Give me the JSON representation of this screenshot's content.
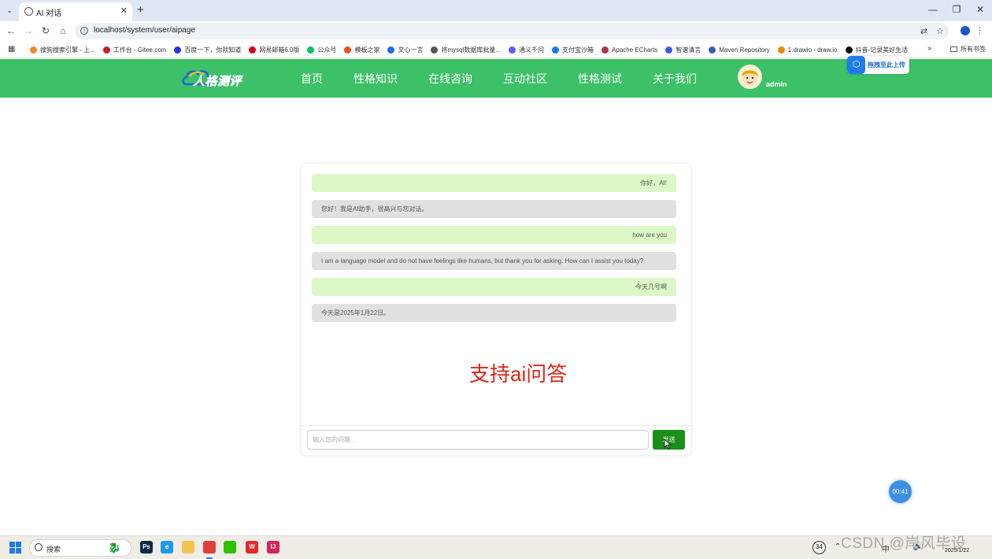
{
  "browser": {
    "tab_title": "AI 对话",
    "tab_close": "✕",
    "new_tab": "+",
    "url": "localhost/system/user/aipage",
    "window_controls": [
      "—",
      "❐",
      "✕"
    ],
    "bookmarks": [
      {
        "label": "搜狗搜索引擎 - 上...",
        "color": "#f08a24"
      },
      {
        "label": "工作台 - Gitee.com",
        "color": "#c71d23"
      },
      {
        "label": "百度一下，你就知道",
        "color": "#2932e1"
      },
      {
        "label": "网易邮箱6.0版",
        "color": "#d0021b"
      },
      {
        "label": "公众号",
        "color": "#07c160"
      },
      {
        "label": "模板之家",
        "color": "#e94e1b"
      },
      {
        "label": "文心一言",
        "color": "#2468f2"
      },
      {
        "label": "将mysql数据库批量...",
        "color": "#555555"
      },
      {
        "label": "通义千问",
        "color": "#615ced"
      },
      {
        "label": "支付宝沙箱",
        "color": "#1677ff"
      },
      {
        "label": "Apache ECharts",
        "color": "#aa344d"
      },
      {
        "label": "智谱清言",
        "color": "#3b5bdb"
      },
      {
        "label": "Maven Repository",
        "color": "#3860a8"
      },
      {
        "label": "1.drawio - draw.io",
        "color": "#f08705"
      },
      {
        "label": "抖音-记录美好生活",
        "color": "#111111"
      }
    ],
    "bookmarks_more": "»",
    "all_bookmarks": "所有书签"
  },
  "site": {
    "logo_text": "人格测评",
    "nav": [
      "首页",
      "性格知识",
      "在线咨询",
      "互动社区",
      "性格测试",
      "关于我们"
    ],
    "username": "admin",
    "upload_widget": "拖拽至此上传",
    "brand_color": "#3cc068"
  },
  "chat": {
    "messages": [
      {
        "role": "user",
        "text": "你好，AI!"
      },
      {
        "role": "ai",
        "text": "您好！我是AI助手，很高兴与您对话。"
      },
      {
        "role": "user",
        "text": "how are you"
      },
      {
        "role": "ai",
        "text": "I am a language model and do not have feelings like humans, but thank you for asking. How can I assist you today?"
      },
      {
        "role": "user",
        "text": "今天几号啊"
      },
      {
        "role": "ai",
        "text": "今天是2025年1月22日。"
      }
    ],
    "annotation": "支持ai问答",
    "input_placeholder": "输入您的问题...",
    "send_label": "发送"
  },
  "timer": "00:41",
  "taskbar": {
    "search_text": "搜索",
    "apps": [
      {
        "icon": "photoshop-icon",
        "label": "Ps",
        "color": "#0b2a4a"
      },
      {
        "icon": "edge-icon",
        "label": "e",
        "color": "#1d9be3"
      },
      {
        "icon": "folder-icon",
        "label": "",
        "color": "#f3c44f"
      },
      {
        "icon": "chrome-icon",
        "label": "",
        "color": "#e0403a"
      },
      {
        "icon": "wechat-icon",
        "label": "",
        "color": "#2dc100"
      },
      {
        "icon": "wps-icon",
        "label": "W",
        "color": "#e02a2a"
      },
      {
        "icon": "idea-icon",
        "label": "IJ",
        "color": "#d6225d"
      }
    ],
    "tray_badge": "34",
    "tray_date": "2025/1/22"
  },
  "watermark": "CSDN @岸风毕设"
}
